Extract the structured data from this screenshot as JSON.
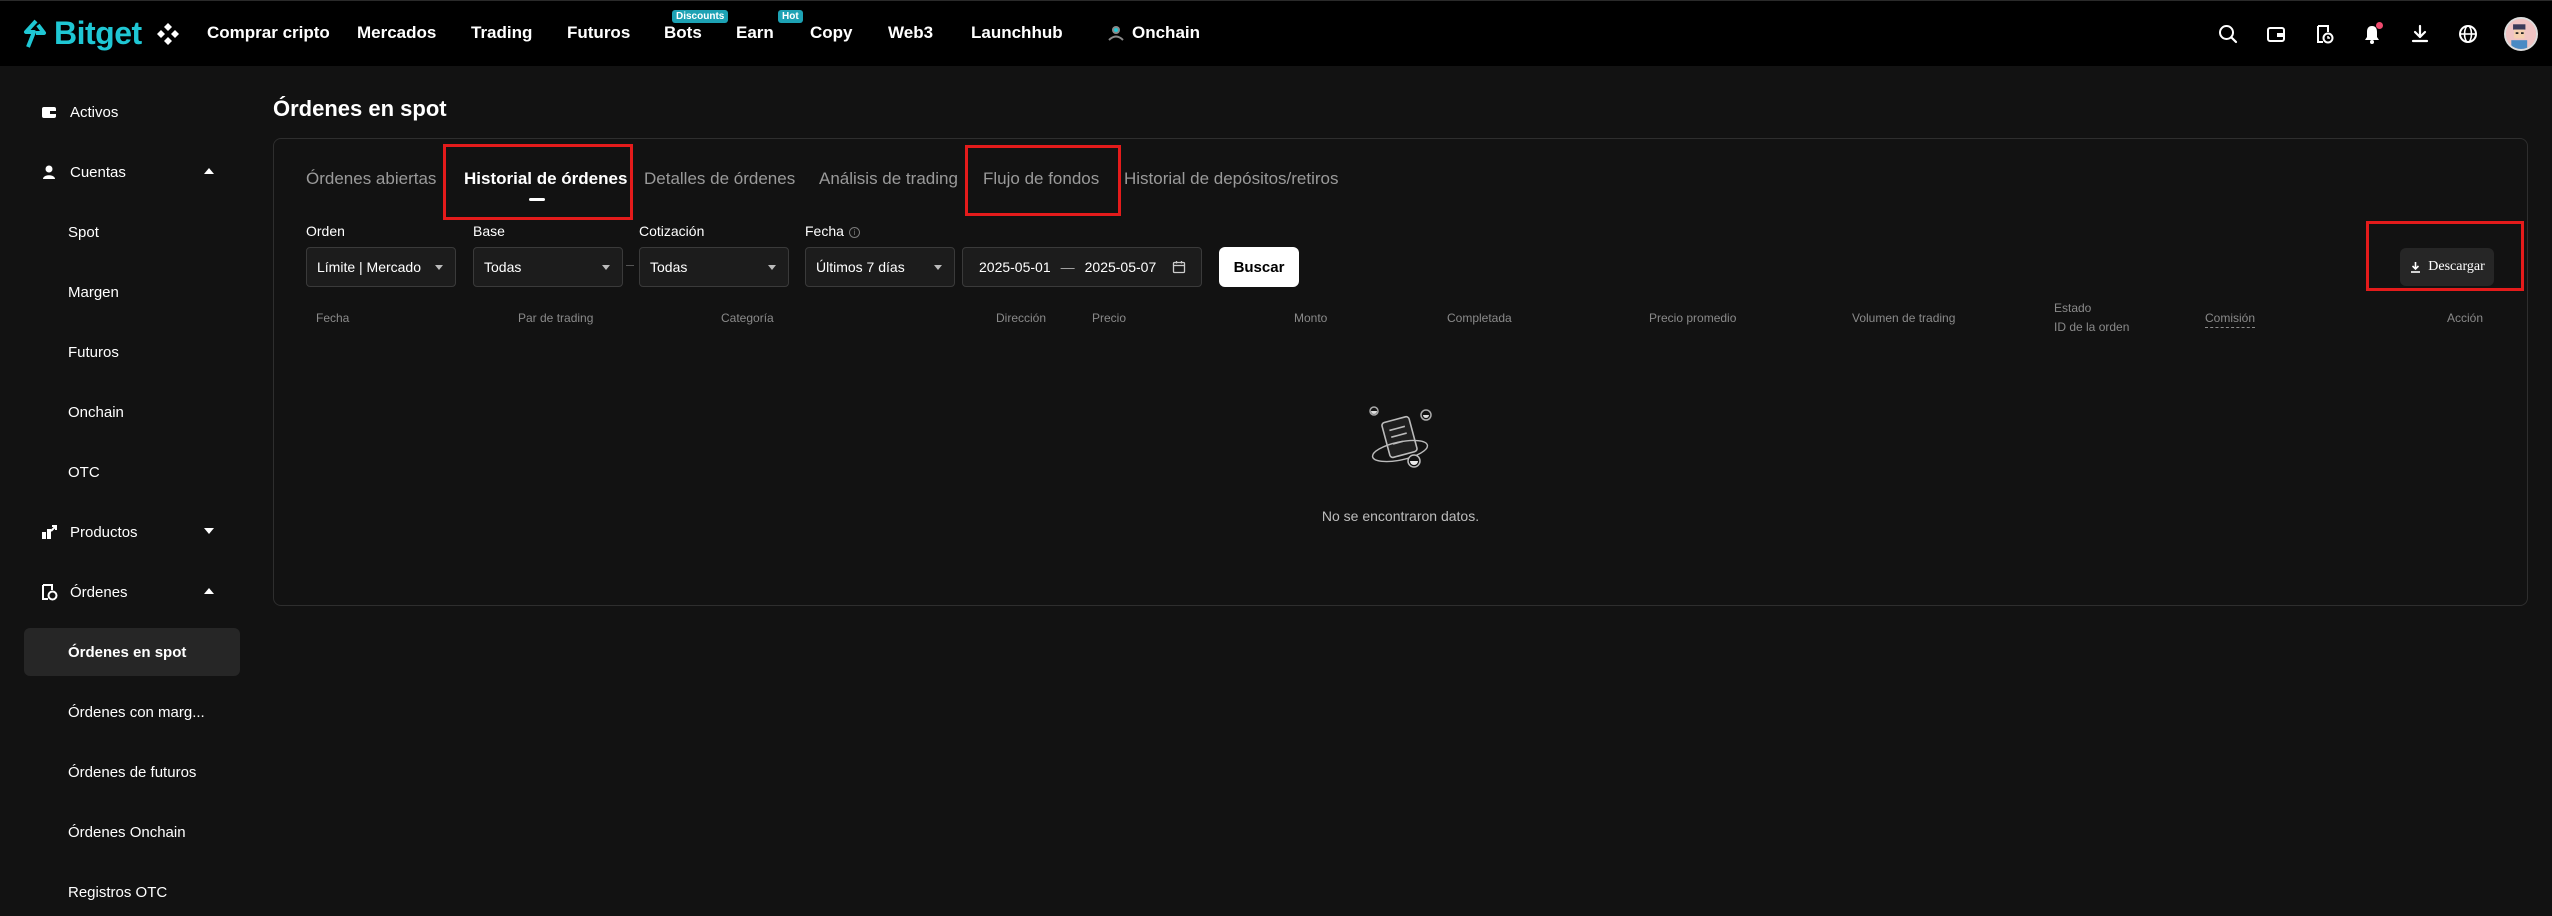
{
  "brand": {
    "name": "Bitget",
    "color": "#1fc7d4"
  },
  "topnav": {
    "items": [
      {
        "label": "Comprar cripto"
      },
      {
        "label": "Mercados"
      },
      {
        "label": "Trading"
      },
      {
        "label": "Futuros"
      },
      {
        "label": "Bots",
        "badge": "Discounts"
      },
      {
        "label": "Earn",
        "badge": "Hot"
      },
      {
        "label": "Copy"
      },
      {
        "label": "Web3"
      },
      {
        "label": "Launchhub"
      },
      {
        "label": "Onchain"
      }
    ],
    "right_icons": [
      "search-icon",
      "wallet-icon",
      "orders-icon",
      "bell-icon",
      "download-icon",
      "globe-icon"
    ]
  },
  "sidebar": {
    "items": [
      {
        "label": "Activos",
        "icon": "wallet-icon"
      },
      {
        "label": "Cuentas",
        "icon": "user-icon",
        "expanded": true
      },
      {
        "label": "Spot"
      },
      {
        "label": "Margen"
      },
      {
        "label": "Futuros"
      },
      {
        "label": "Onchain"
      },
      {
        "label": "OTC"
      },
      {
        "label": "Productos",
        "icon": "products-icon",
        "expanded": false
      },
      {
        "label": "Órdenes",
        "icon": "orders-icon",
        "expanded": true
      },
      {
        "label": "Órdenes en spot",
        "active": true
      },
      {
        "label": "Órdenes con marg..."
      },
      {
        "label": "Órdenes de futuros"
      },
      {
        "label": "Órdenes Onchain"
      },
      {
        "label": "Registros OTC"
      }
    ]
  },
  "main": {
    "title": "Órdenes en spot",
    "tabs": [
      {
        "label": "Órdenes abiertas"
      },
      {
        "label": "Historial de órdenes",
        "active": true
      },
      {
        "label": "Detalles de órdenes"
      },
      {
        "label": "Análisis de trading"
      },
      {
        "label": "Flujo de fondos"
      },
      {
        "label": "Historial de depósitos/retiros"
      }
    ],
    "filters": {
      "orden": {
        "label": "Orden",
        "value": "Límite | Mercado"
      },
      "base": {
        "label": "Base",
        "value": "Todas"
      },
      "cotizacion": {
        "label": "Cotización",
        "value": "Todas"
      },
      "fecha": {
        "label": "Fecha",
        "value": "Últimos 7 días"
      },
      "date_from": "2025-05-01",
      "date_to": "2025-05-07",
      "date_sep": "—"
    },
    "search_label": "Buscar",
    "download_label": "Descargar",
    "columns": {
      "fecha": "Fecha",
      "par": "Par de trading",
      "categoria": "Categoría",
      "direccion": "Dirección",
      "precio": "Precio",
      "monto": "Monto",
      "completada": "Completada",
      "precio_promedio": "Precio promedio",
      "volumen": "Volumen de trading",
      "estado": "Estado",
      "id_orden": "ID de la orden",
      "comision": "Comisión",
      "accion": "Acción"
    },
    "empty_text": "No se encontraron datos."
  },
  "highlight_color": "#e41b1b"
}
